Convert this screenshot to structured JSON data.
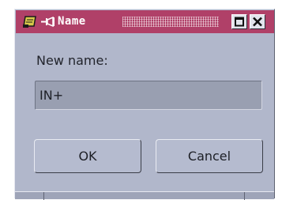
{
  "window": {
    "title": "Name",
    "title_bar_color": "#b04068",
    "icons": [
      "app-icon",
      "pin-icon",
      "maximize-icon",
      "close-icon"
    ]
  },
  "form": {
    "label": "New name:",
    "input_value": "IN+"
  },
  "buttons": {
    "ok_label": "OK",
    "cancel_label": "Cancel"
  }
}
